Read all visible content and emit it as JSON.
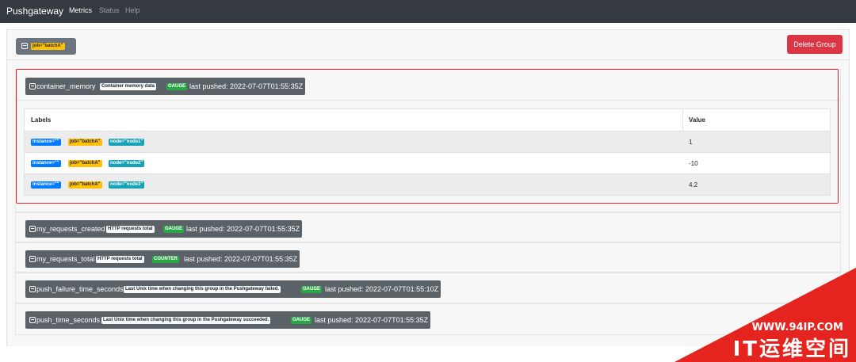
{
  "navbar": {
    "brand": "Pushgateway",
    "links": [
      "Metrics",
      "Status",
      "Help"
    ]
  },
  "group": {
    "label": "job=\"batchA\"",
    "delete_label": "Delete Group"
  },
  "metrics": [
    {
      "name": "container_memory",
      "help": "Container memory data",
      "type": "GAUGE",
      "last_pushed": "last pushed: 2022-07-07T01:55:35Z",
      "expanded": true,
      "table": {
        "headers": [
          "Labels",
          "Value"
        ],
        "rows": [
          {
            "labels": [
              "instance=\"\"",
              "job=\"batchA\"",
              "node=\"node1\""
            ],
            "value": "1"
          },
          {
            "labels": [
              "instance=\"\"",
              "job=\"batchA\"",
              "node=\"node2\""
            ],
            "value": "-10"
          },
          {
            "labels": [
              "instance=\"\"",
              "job=\"batchA\"",
              "node=\"node3\""
            ],
            "value": "4.2"
          }
        ]
      }
    },
    {
      "name": "my_requests_created",
      "help": "HTTP requests total",
      "type": "GAUGE",
      "last_pushed": "last pushed: 2022-07-07T01:55:35Z"
    },
    {
      "name": "my_requests_total",
      "help": "HTTP requests total",
      "type": "COUNTER",
      "last_pushed": "last pushed: 2022-07-07T01:55:35Z"
    },
    {
      "name": "push_failure_time_seconds",
      "help": "Last Unix time when changing this group in the Pushgateway failed.",
      "type": "GAUGE",
      "last_pushed": "last pushed: 2022-07-07T01:55:10Z"
    },
    {
      "name": "push_time_seconds",
      "help": "Last Unix time when changing this group in the Pushgateway succeeded.",
      "type": "GAUGE",
      "last_pushed": "last pushed: 2022-07-07T01:55:35Z"
    }
  ],
  "watermark": {
    "url": "WWW.94IP.COM",
    "text": "IT运维空间"
  },
  "colors": {
    "navbar": "#343a40",
    "danger": "#dc3545",
    "highlight_box": "#e52020",
    "watermark": "#e6241f"
  }
}
